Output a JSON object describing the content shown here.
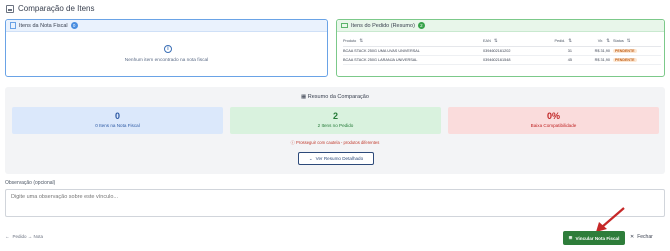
{
  "header": {
    "title": "Comparação de Itens"
  },
  "nota_panel": {
    "title": "Itens da Nota Fiscal",
    "count": "0",
    "empty_message": "Nenhum item encontrado na nota fiscal"
  },
  "pedido_panel": {
    "title": "Itens do Pedido (Resumo)",
    "count": "2",
    "columns": [
      "Produto",
      "EAN",
      "Pedid.",
      "Vlr.",
      "Status"
    ],
    "rows": [
      {
        "produto": "BCAA STACK 250G UMA UVAS UNIVERSAL",
        "ean": "0394602161202",
        "qtd": "31",
        "valor": "R$ 31,90",
        "status": "PENDENTE"
      },
      {
        "produto": "BCAA STACK 250G LARANJA UNIVERSAL",
        "ean": "0394602161548",
        "qtd": "45",
        "valor": "R$ 31,90",
        "status": "PENDENTE"
      }
    ]
  },
  "summary": {
    "title": "Resumo da Comparação",
    "cards": [
      {
        "value": "0",
        "label": "0 Itens na Nota Fiscal"
      },
      {
        "value": "2",
        "label": "2 Itens no Pedido"
      },
      {
        "value": "0%",
        "label": "Baixa Compatibilidade"
      }
    ],
    "warning": "Prosseguir com cautela - produtos diferentes",
    "detail_button": "Ver Resumo Detalhado"
  },
  "observacao": {
    "label": "Observação (opcional)",
    "placeholder": "Digite uma observação sobre este vínculo..."
  },
  "footer": {
    "back": "Pedido → Nota",
    "vincular": "Vincular Nota Fiscal",
    "fechar": "Fechar"
  },
  "colors": {
    "blue_accent": "#4a8ee0",
    "green_accent": "#37a34a",
    "red_accent": "#c02626",
    "primary_button": "#2e7d3a",
    "arrow": "#c62828"
  }
}
